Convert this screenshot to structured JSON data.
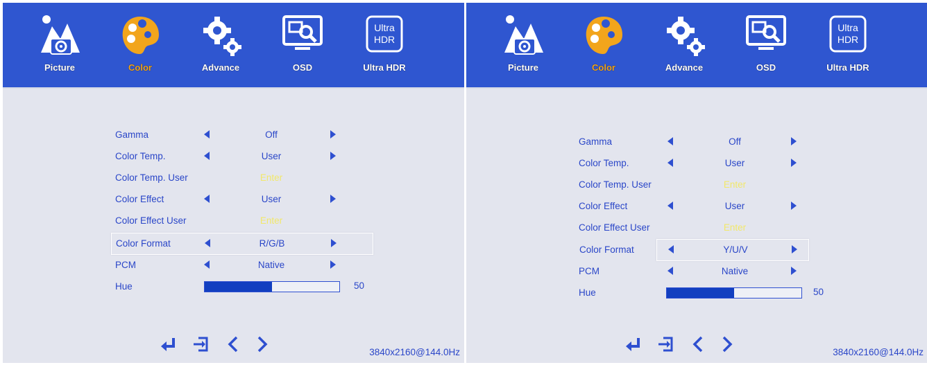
{
  "panels": [
    {
      "tabs": [
        {
          "label": "Picture",
          "icon": "picture-icon"
        },
        {
          "label": "Color",
          "icon": "color-palette-icon"
        },
        {
          "label": "Advance",
          "icon": "gears-icon"
        },
        {
          "label": "OSD",
          "icon": "monitor-search-icon"
        },
        {
          "label": "Ultra HDR",
          "icon": "ultra-hdr-icon",
          "badge": [
            "Ultra",
            "HDR"
          ]
        }
      ],
      "active_tab": "Color",
      "menu": [
        {
          "label": "Gamma",
          "value": "Off",
          "kind": "select"
        },
        {
          "label": "Color Temp.",
          "value": "User",
          "kind": "select"
        },
        {
          "label": "Color Temp. User",
          "value": "Enter",
          "kind": "enter"
        },
        {
          "label": "Color Effect",
          "value": "User",
          "kind": "select"
        },
        {
          "label": "Color Effect User",
          "value": "Enter",
          "kind": "enter"
        },
        {
          "label": "Color Format",
          "value": "R/G/B",
          "kind": "select",
          "selected": true
        },
        {
          "label": "PCM",
          "value": "Native",
          "kind": "select"
        },
        {
          "label": "Hue",
          "value": "50",
          "kind": "slider",
          "level": 0.5
        }
      ],
      "footer_icons": [
        "enter-icon",
        "exit-icon",
        "left-nav-icon",
        "right-nav-icon"
      ],
      "resolution": "3840x2160@144.0Hz"
    },
    {
      "tabs": [
        {
          "label": "Picture",
          "icon": "picture-icon"
        },
        {
          "label": "Color",
          "icon": "color-palette-icon"
        },
        {
          "label": "Advance",
          "icon": "gears-icon"
        },
        {
          "label": "OSD",
          "icon": "monitor-search-icon"
        },
        {
          "label": "Ultra HDR",
          "icon": "ultra-hdr-icon",
          "badge": [
            "Ultra",
            "HDR"
          ]
        }
      ],
      "active_tab": "Color",
      "menu": [
        {
          "label": "Gamma",
          "value": "Off",
          "kind": "select"
        },
        {
          "label": "Color Temp.",
          "value": "User",
          "kind": "select"
        },
        {
          "label": "Color Temp. User",
          "value": "Enter",
          "kind": "enter"
        },
        {
          "label": "Color Effect",
          "value": "User",
          "kind": "select"
        },
        {
          "label": "Color Effect User",
          "value": "Enter",
          "kind": "enter"
        },
        {
          "label": "Color Format",
          "value": "Y/U/V",
          "kind": "select",
          "selected": true
        },
        {
          "label": "PCM",
          "value": "Native",
          "kind": "select"
        },
        {
          "label": "Hue",
          "value": "50",
          "kind": "slider",
          "level": 0.5
        }
      ],
      "footer_icons": [
        "enter-icon",
        "exit-icon",
        "left-nav-icon",
        "right-nav-icon"
      ],
      "resolution": "3840x2160@144.0Hz"
    }
  ],
  "colors": {
    "topbar": "#2f56d0",
    "background": "#e3e5ee",
    "text": "#2a46c8",
    "active_tab": "#f2a51c",
    "enter_text": "#f2e86a",
    "slider_fill": "#123fc0"
  }
}
